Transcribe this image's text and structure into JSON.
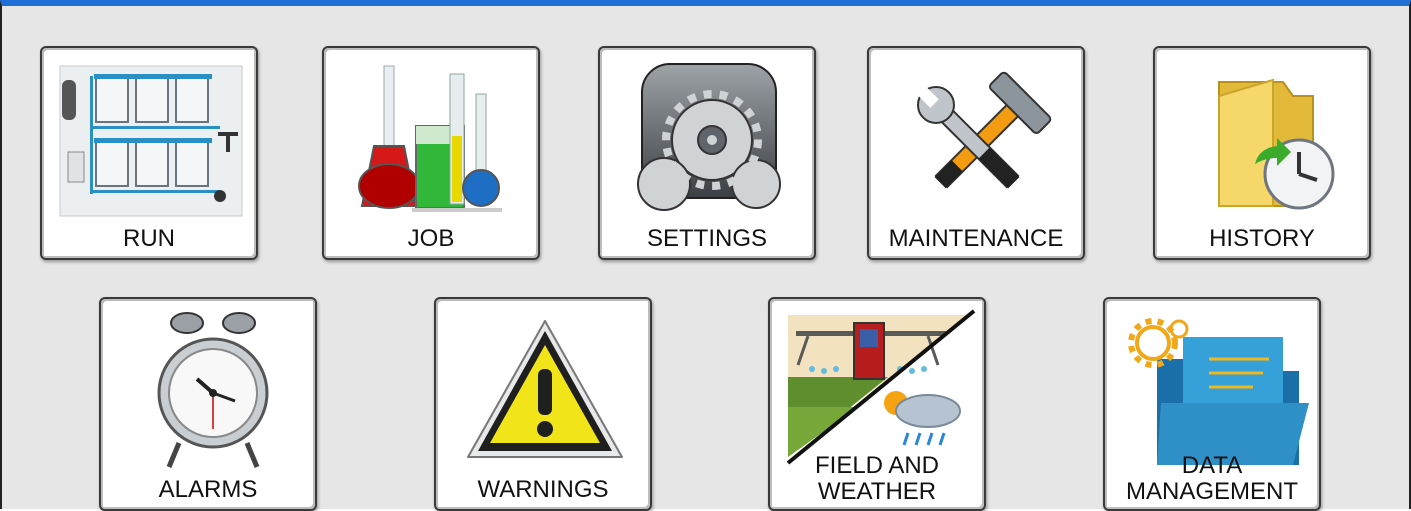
{
  "tiles_row1": [
    {
      "id": "run",
      "label": "RUN",
      "icon": "sprayer-tanks-icon"
    },
    {
      "id": "job",
      "label": "JOB",
      "icon": "lab-flasks-icon"
    },
    {
      "id": "settings",
      "label": "SETTINGS",
      "icon": "gears-icon"
    },
    {
      "id": "maintenance",
      "label": "MAINTENANCE",
      "icon": "hammer-wrench-icon"
    },
    {
      "id": "history",
      "label": "HISTORY",
      "icon": "folder-clock-icon"
    }
  ],
  "tiles_row2": [
    {
      "id": "alarms",
      "label": "ALARMS",
      "icon": "alarm-clock-icon"
    },
    {
      "id": "warnings",
      "label": "WARNINGS",
      "icon": "warning-triangle-icon"
    },
    {
      "id": "field_weather",
      "label_line1": "FIELD AND",
      "label_line2": "WEATHER",
      "icon": "field-weather-icon"
    },
    {
      "id": "data_management",
      "label_line1": "DATA",
      "label_line2": "MANAGEMENT",
      "icon": "data-folder-icon"
    }
  ],
  "colors": {
    "header_bar": "#1f6fd6",
    "background": "#e6e6e6",
    "tile": "#ffffff"
  }
}
